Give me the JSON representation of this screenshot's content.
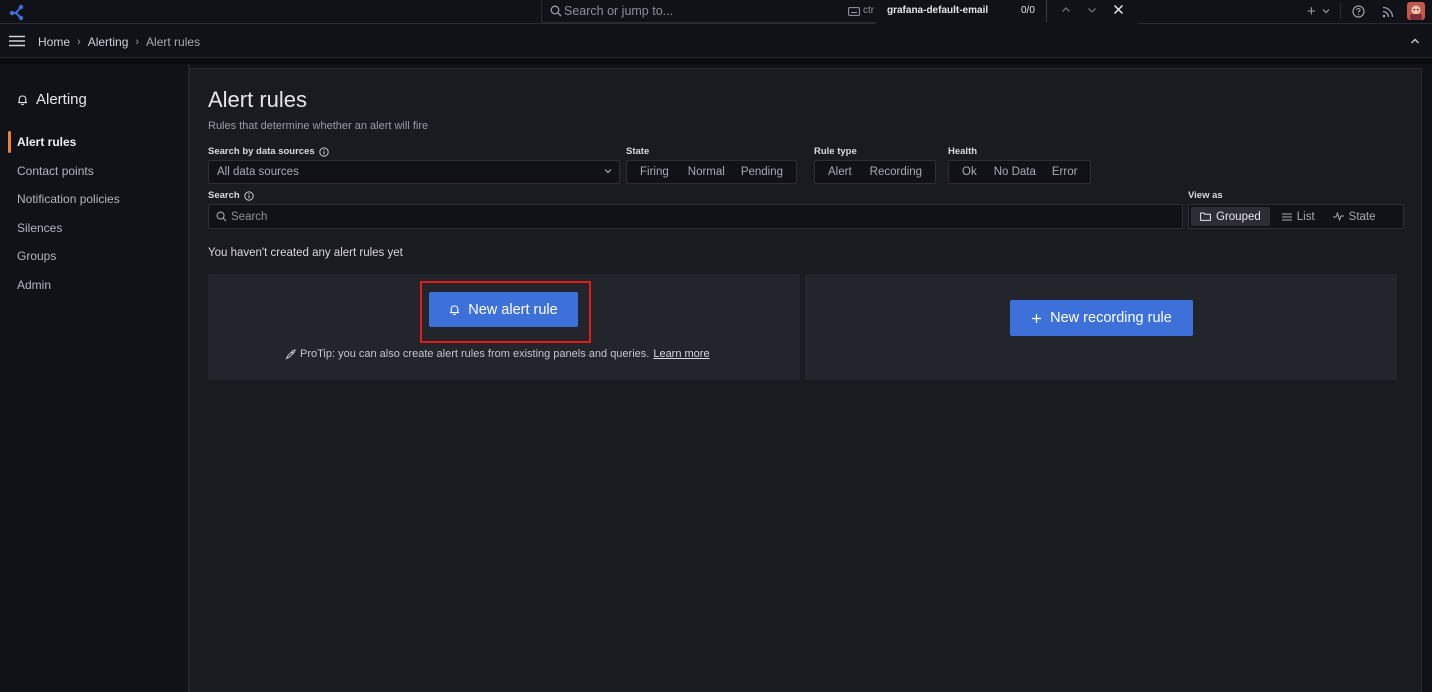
{
  "topbar": {
    "search_placeholder": "Search or jump to...",
    "search_shortcut": "ctr",
    "find_value": "grafana-default-email",
    "find_count": "0/0",
    "add_symbol": "+"
  },
  "breadcrumb": {
    "items": [
      "Home",
      "Alerting",
      "Alert rules"
    ]
  },
  "sidebar": {
    "title": "Alerting",
    "items": [
      {
        "label": "Alert rules",
        "active": true
      },
      {
        "label": "Contact points"
      },
      {
        "label": "Notification policies"
      },
      {
        "label": "Silences"
      },
      {
        "label": "Groups"
      },
      {
        "label": "Admin"
      }
    ]
  },
  "main": {
    "title": "Alert rules",
    "subtitle": "Rules that determine whether an alert will fire",
    "filters": {
      "datasource_label": "Search by data sources",
      "datasource_value": "All data sources",
      "state_label": "State",
      "state_options": [
        "Firing",
        "Normal",
        "Pending"
      ],
      "rule_type_label": "Rule type",
      "rule_type_options": [
        "Alert",
        "Recording"
      ],
      "health_label": "Health",
      "health_options": [
        "Ok",
        "No Data",
        "Error"
      ],
      "search_label": "Search",
      "search_placeholder": "Search",
      "view_as_label": "View as",
      "view_options": [
        "Grouped",
        "List",
        "State"
      ],
      "view_selected": "Grouped"
    },
    "empty_message": "You haven't created any alert rules yet",
    "new_alert_rule": "New alert rule",
    "new_recording_rule": "New recording rule",
    "protip": "ProTip: you can also create alert rules from existing panels and queries.",
    "learn_more": "Learn more"
  },
  "colors": {
    "accent_orange": "#f47e34",
    "primary_blue": "#3d71d9",
    "highlight_red": "#e31b1b"
  }
}
